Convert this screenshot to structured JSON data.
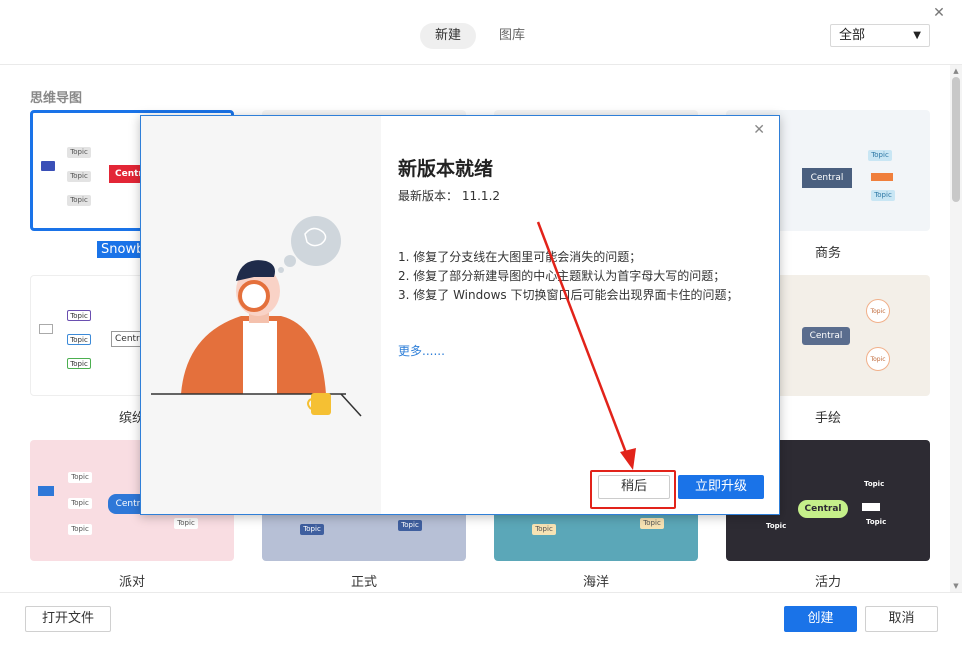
{
  "header": {
    "close_glyph": "✕",
    "tabs": [
      {
        "label": "新建",
        "active": true
      },
      {
        "label": "图库",
        "active": false
      }
    ],
    "filter": {
      "value": "全部",
      "chevron": "⌄"
    }
  },
  "section": {
    "title": "思维导图"
  },
  "templates": [
    {
      "label": "Snowb",
      "selected": true,
      "theme": "snowball"
    },
    {
      "label": "",
      "theme": "hidden-1"
    },
    {
      "label": "",
      "theme": "hidden-2"
    },
    {
      "label": "商务",
      "theme": "business"
    },
    {
      "label": "缤纷",
      "theme": "colorful"
    },
    {
      "label": "手绘",
      "theme": "handdrawn"
    },
    {
      "label": "派对",
      "theme": "party"
    },
    {
      "label": "正式",
      "theme": "formal"
    },
    {
      "label": "海洋",
      "theme": "ocean"
    },
    {
      "label": "活力",
      "theme": "vibrant"
    }
  ],
  "mini_text": {
    "topic": "Topic",
    "central": "Central",
    "central_partial": "Centra"
  },
  "footer": {
    "open_file": "打开文件",
    "create": "创建",
    "cancel": "取消"
  },
  "dialog": {
    "close_glyph": "✕",
    "title": "新版本就绪",
    "version_label": "最新版本：",
    "version_value": "11.1.2",
    "notes": [
      "1. 修复了分支线在大图里可能会消失的问题；",
      "2. 修复了部分新建导图的中心主题默认为首字母大写的问题；",
      "3. 修复了 Windows 下切换窗口后可能会出现界面卡住的问题；"
    ],
    "more_link": "更多......",
    "later_button": "稍后",
    "upgrade_button": "立即升级"
  },
  "colors": {
    "accent": "#1a73e8",
    "annotation_red": "#e2231a",
    "party_bg": "#f9dde2",
    "formal_bg": "#b7c0d6",
    "ocean_bg": "#5ba7b8",
    "vibrant_bg": "#2d2b33",
    "handdrawn_bg": "#f3efe8"
  }
}
